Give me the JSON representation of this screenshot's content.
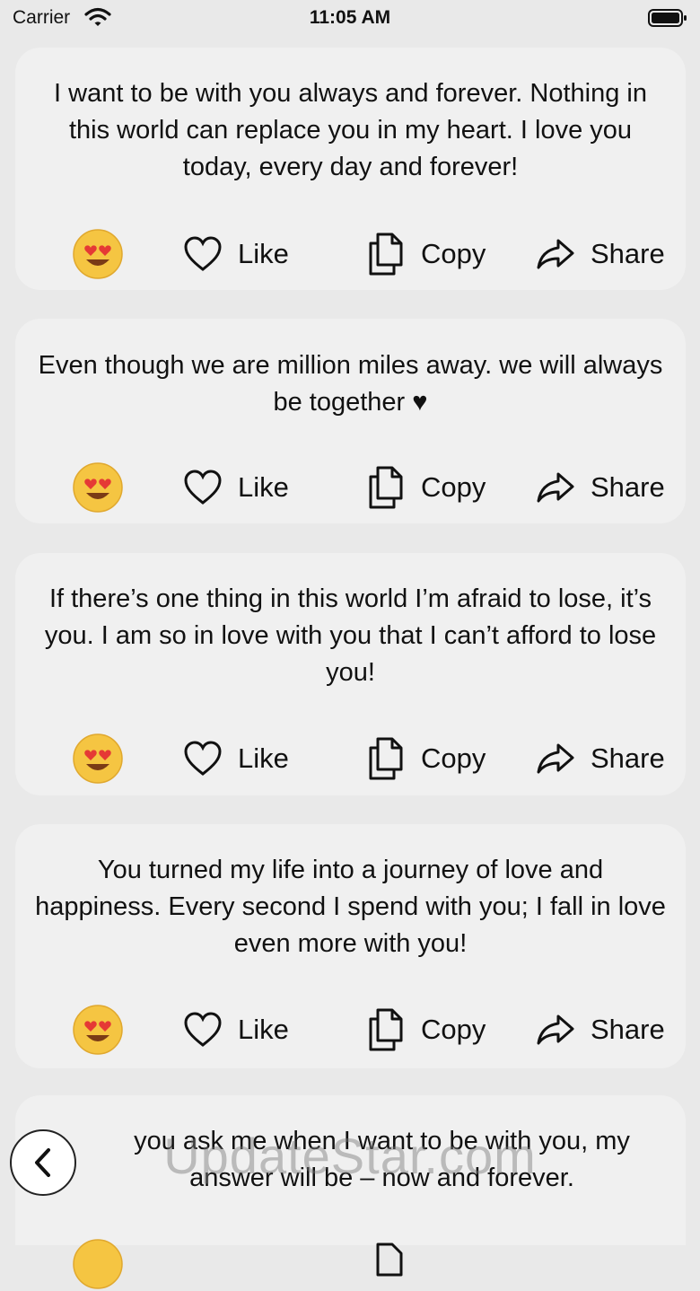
{
  "status_bar": {
    "carrier": "Carrier",
    "time": "11:05 AM"
  },
  "actions": {
    "like": "Like",
    "copy": "Copy",
    "share": "Share"
  },
  "quotes": [
    "I want to be with you always and forever. Nothing in this world can replace you in my heart. I love you today, every day and forever!",
    "Even though we are million miles away. we will always be together ♥",
    "If there’s one thing in this world I’m afraid to lose, it’s you. I am so in love with you that I can’t afford to lose you!",
    "You turned my life into a journey of love and happiness. Every second I spend with you; I fall in love even more with you!",
    "you ask me when I want to be with you, my answer will be – now and forever."
  ],
  "watermark": "UpdateStar.com",
  "icons": {
    "emoji": "heart-eyes-emoji",
    "like": "heart-outline-icon",
    "copy": "copy-icon",
    "share": "share-arrow-icon",
    "back": "chevron-left-icon"
  }
}
